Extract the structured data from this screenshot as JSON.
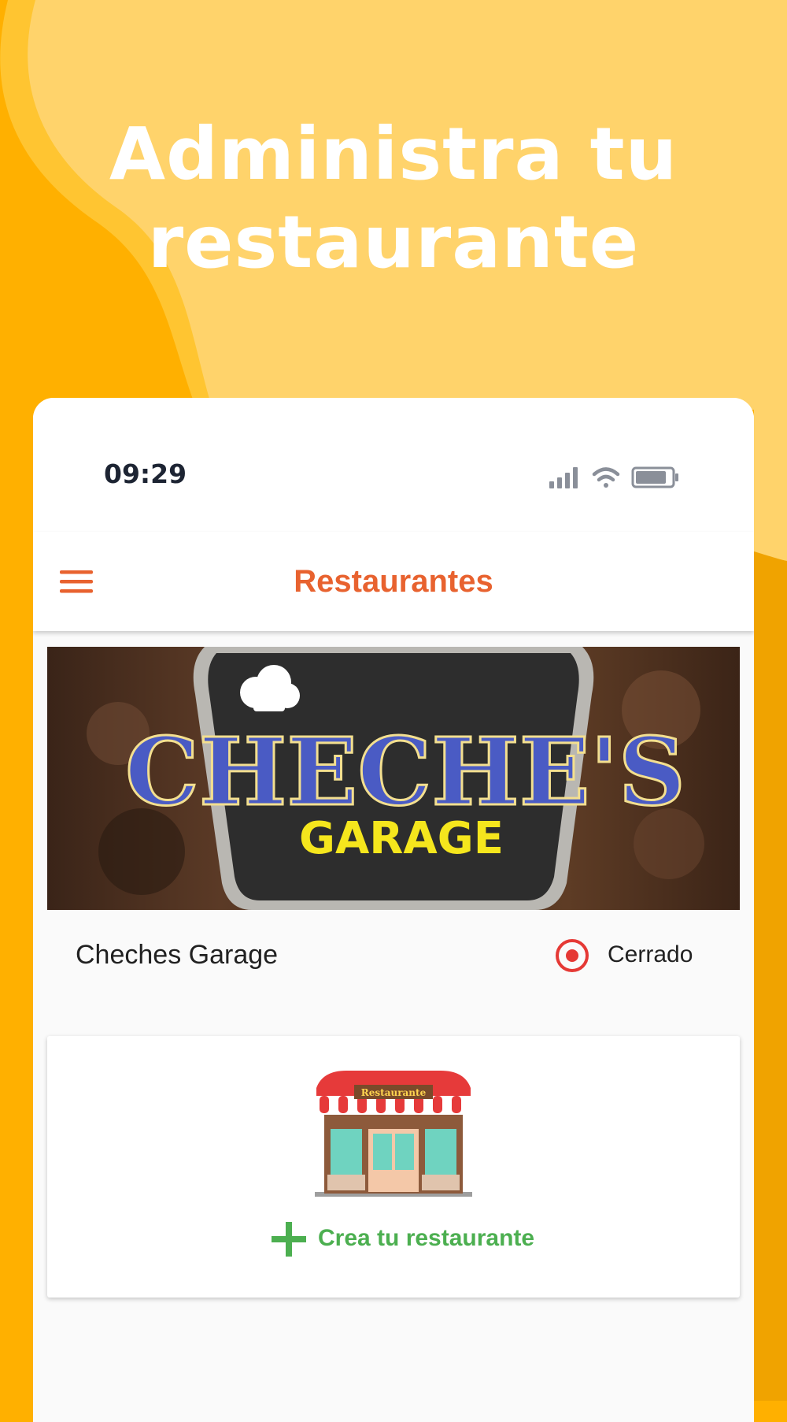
{
  "hero": {
    "title_line1": "Administra tu",
    "title_line2": "restaurante"
  },
  "status_bar": {
    "time": "09:29",
    "icons": [
      "signal-icon",
      "wifi-icon",
      "battery-icon"
    ]
  },
  "app_bar": {
    "title": "Restaurantes",
    "menu_icon": "hamburger-menu-icon"
  },
  "restaurants": [
    {
      "name": "Cheches Garage",
      "logo_text_top": "CHECHE'S",
      "logo_text_bottom": "GARAGE",
      "status": "Cerrado",
      "status_icon": "radio-selected-icon"
    }
  ],
  "create_card": {
    "label": "Crea tu restaurante",
    "sign_text": "Restaurante",
    "icon": "plus-icon",
    "illustration": "storefront-icon"
  },
  "colors": {
    "background": "#ffb000",
    "background_light": "#ffd36b",
    "accent": "#e8622f",
    "status_closed": "#e53935",
    "create_green": "#4caf50"
  }
}
